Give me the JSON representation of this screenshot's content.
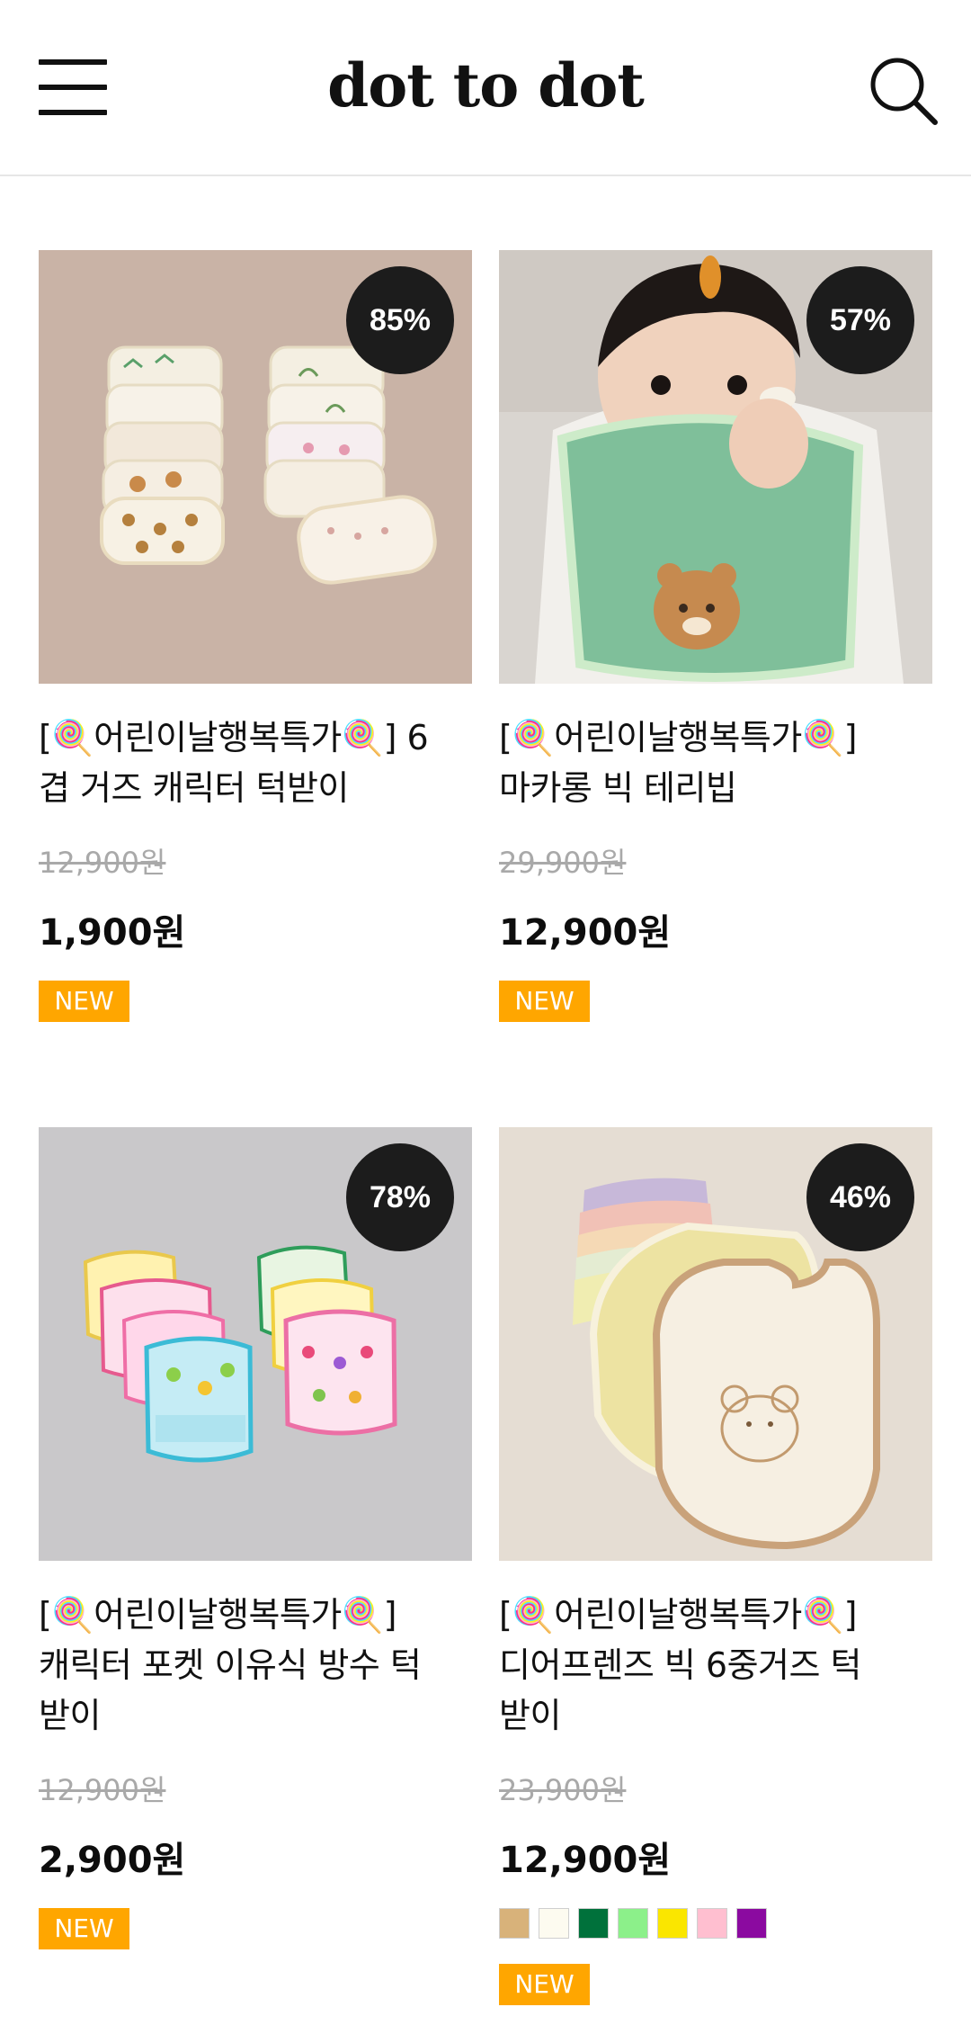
{
  "header": {
    "logo": "dot to dot",
    "menu_icon": "hamburger-menu-icon",
    "search_icon": "search-icon"
  },
  "products": [
    {
      "discount": "85%",
      "title_line1": "[🍭어린이날행복특가🍭] 6",
      "title_line2": "겹 거즈 캐릭터 턱받이",
      "title_line3": "",
      "old_price": "12,900원",
      "price": "1,900원",
      "tag": "NEW"
    },
    {
      "discount": "57%",
      "title_line1": "[🍭어린이날행복특가🍭]",
      "title_line2": "마카롱 빅 테리빕",
      "title_line3": "",
      "old_price": "29,900원",
      "price": "12,900원",
      "tag": "NEW"
    },
    {
      "discount": "78%",
      "title_line1": "[🍭어린이날행복특가🍭]",
      "title_line2": "캐릭터 포켓 이유식 방수 턱",
      "title_line3": "받이",
      "old_price": "12,900원",
      "price": "2,900원",
      "tag": "NEW"
    },
    {
      "discount": "46%",
      "title_line1": "[🍭어린이날행복특가🍭]",
      "title_line2": "디어프렌즈 빅 6중거즈 턱",
      "title_line3": "받이",
      "old_price": "23,900원",
      "price": "12,900원",
      "swatches": [
        "#d8b27a",
        "#fdfbf0",
        "#00713b",
        "#8cf08a",
        "#fae600",
        "#ffbfd0",
        "#8b0aa0"
      ],
      "tag": "NEW"
    }
  ],
  "colors": {
    "badge_bg": "#1c1c1c",
    "new_tag_bg": "#ffa600",
    "old_price": "#a9a9a9"
  }
}
